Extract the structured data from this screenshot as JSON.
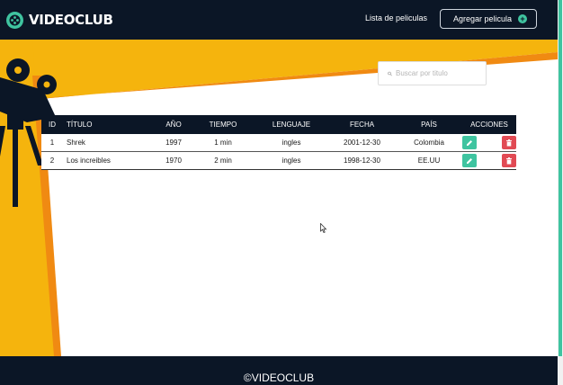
{
  "navbar": {
    "brand": "VIDEOCLUB",
    "logo_icon": "film-reel-icon",
    "link_movies": "Lista de peliculas",
    "add_button": "Agregar pelicula",
    "add_icon": "plus-circle-icon"
  },
  "search": {
    "placeholder": "Buscar por titulo",
    "icon": "search-icon"
  },
  "table": {
    "headers": {
      "id": "ID",
      "title": "TÍTULO",
      "year": "AÑO",
      "time": "TIEMPO",
      "language": "LENGUAJE",
      "date": "FECHA",
      "country": "PAÍS",
      "actions": "ACCIONES"
    },
    "rows": [
      {
        "id": "1",
        "title": "Shrek",
        "year": "1997",
        "time": "1 min",
        "language": "ingles",
        "date": "2001-12-30",
        "country": "Colombia"
      },
      {
        "id": "2",
        "title": "Los increibles",
        "year": "1970",
        "time": "2 min",
        "language": "ingles",
        "date": "1998-12-30",
        "country": "EE.UU"
      }
    ],
    "edit_icon": "pencil-icon",
    "delete_icon": "trash-icon"
  },
  "footer": {
    "text": "©VIDEOCLUB"
  },
  "colors": {
    "navy": "#0b1626",
    "yellow": "#f5b40d",
    "orange": "#f08a12",
    "teal": "#3fc4a0",
    "red": "#e14a54"
  }
}
